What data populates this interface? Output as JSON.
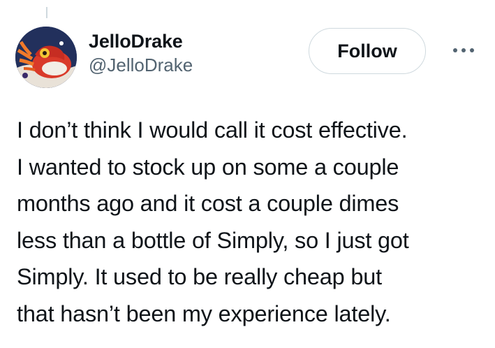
{
  "author": {
    "display_name": "JelloDrake",
    "handle": "@JelloDrake"
  },
  "actions": {
    "follow_label": "Follow",
    "more_icon": "more-horizontal-icon"
  },
  "avatar": {
    "icon": "avatar-image"
  },
  "tweet": {
    "lines": [
      "I don’t think I would call it cost effective.",
      "I wanted to stock up on some a couple",
      "months ago and it cost a couple dimes",
      "less than a bottle of Simply, so I just got",
      "Simply. It used to be really cheap but",
      "that hasn’t been my experience lately."
    ]
  },
  "colors": {
    "text_primary": "#0f1419",
    "text_secondary": "#536471",
    "border": "#cfd9de"
  }
}
